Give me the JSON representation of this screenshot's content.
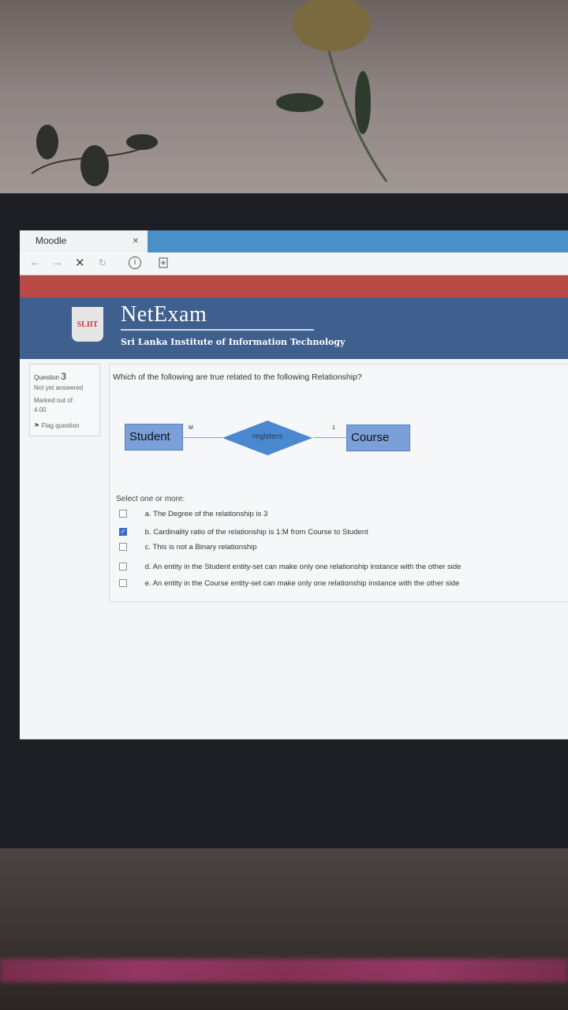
{
  "browser": {
    "tab_title": "Moodle",
    "tab_close": "×",
    "nav_back": "←",
    "nav_forward": "→",
    "nav_stop": "✕",
    "nav_reload": "↻",
    "site_info": "i"
  },
  "header": {
    "logo_text": "SLIIT",
    "brand": "NetExam",
    "subtitle": "Sri Lanka Institute of Information Technology"
  },
  "question_info": {
    "label": "Question",
    "number": "3",
    "status": "Not yet answered",
    "marked": "Marked out of",
    "max_mark": "4.00",
    "flag": "Flag question"
  },
  "question": {
    "text": "Which of the following are true related to the following Relationship?",
    "diagram": {
      "left_entity": "Student",
      "relationship": "registers",
      "right_entity": "Course",
      "left_cardinality": "M",
      "right_cardinality": "1"
    },
    "select_label": "Select one or more:",
    "options": [
      {
        "label": "a. The Degree of the relationship is 3",
        "checked": false
      },
      {
        "label": "b. Cardinality ratio of the relationship is 1:M from Course to Student",
        "checked": true
      },
      {
        "label": "c. This is not a Binary relationship",
        "checked": false
      },
      {
        "label": "d. An entity in the Student entity-set can make only one relationship instance with the other side",
        "checked": false
      },
      {
        "label": "e. An entity in the Course entity-set can make only one relationship instance with the other side",
        "checked": false
      }
    ]
  },
  "colors": {
    "header_bg": "#3f5f8e",
    "red_band": "#b74a44",
    "entity_fill": "#7b9fd8",
    "relationship_fill": "#4a88d0",
    "checkbox_checked": "#3a6fc4"
  }
}
